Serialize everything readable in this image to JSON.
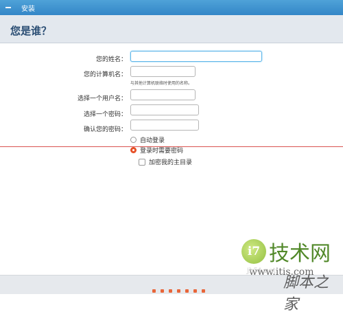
{
  "window": {
    "title": "安装"
  },
  "page": {
    "heading": "您是谁？"
  },
  "form": {
    "name_label": "您的姓名：",
    "name_value": "",
    "computer_label": "您的计算机名：",
    "computer_value": "",
    "computer_hint": "与其他计算机联络时使用的名称。",
    "username_label": "选择一个用户名：",
    "username_value": "",
    "password_label": "选择一个密码：",
    "password_value": "",
    "confirm_label": "确认您的密码：",
    "confirm_value": ""
  },
  "login_options": {
    "auto_login": "自动登录",
    "require_password": "登录时需要密码",
    "selected": "require_password",
    "encrypt_home": "加密我的主目录",
    "encrypt_home_checked": false
  },
  "progress": {
    "steps": 7
  },
  "watermark": {
    "logo_mark": "i7",
    "name": "技术网",
    "url": "www.itis.com",
    "site": "jb51.net",
    "brand": "脚本之家"
  },
  "colors": {
    "titlebar": "#3b8fcf",
    "accent": "#e8532b",
    "heading": "#2a4d73"
  }
}
